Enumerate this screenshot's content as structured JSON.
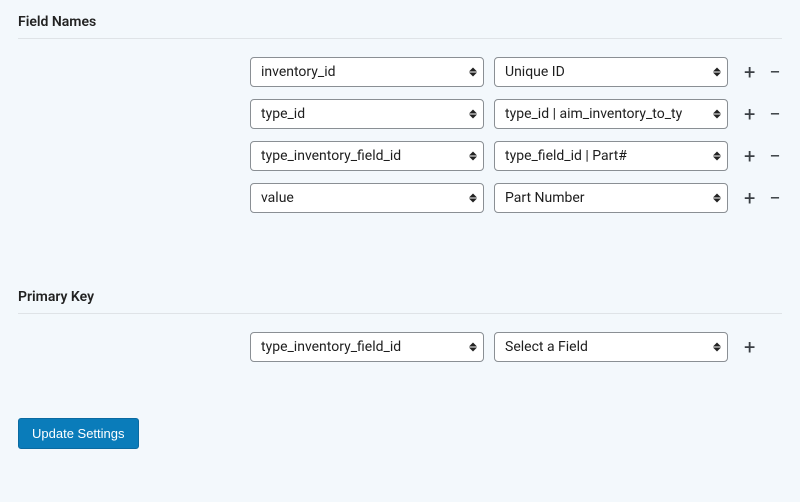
{
  "sections": {
    "field_names": {
      "heading": "Field Names",
      "rows": [
        {
          "left": "inventory_id",
          "right": "Unique ID"
        },
        {
          "left": "type_id",
          "right": "type_id | aim_inventory_to_ty"
        },
        {
          "left": "type_inventory_field_id",
          "right": "type_field_id | Part#"
        },
        {
          "left": "value",
          "right": "Part Number"
        }
      ]
    },
    "primary_key": {
      "heading": "Primary Key",
      "rows": [
        {
          "left": "type_inventory_field_id",
          "right": "Select a Field"
        }
      ]
    }
  },
  "buttons": {
    "update": "Update Settings"
  },
  "icons": {
    "plus": "+",
    "minus": "−"
  }
}
